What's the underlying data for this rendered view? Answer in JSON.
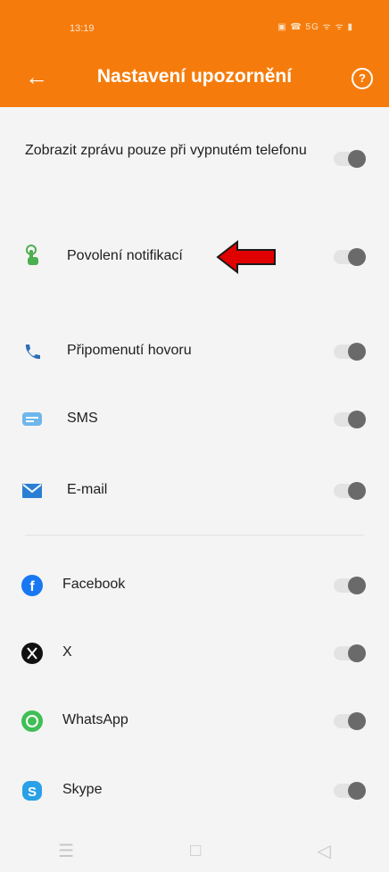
{
  "status": {
    "time": "13:19",
    "icons_text": "▣ ☎ 5G ᯤ ᯤ ▮"
  },
  "header": {
    "back_icon": "arrow-left-icon",
    "title": "Nastavení upozornění",
    "help_icon": "help-circle-icon",
    "help_label": "?"
  },
  "settings": [
    {
      "label": "Zobrazit zprávu pouze při vypnutém telefonu",
      "enabled": false
    },
    {
      "label": "Povolení notifikací",
      "icon": "touch-hand-icon",
      "enabled": false
    },
    {
      "label": "Připomenutí hovoru",
      "icon": "phone-icon",
      "enabled": false
    },
    {
      "label": "SMS",
      "icon": "sms-icon",
      "enabled": false
    },
    {
      "label": "E-mail",
      "icon": "email-icon",
      "enabled": false
    },
    {
      "label": "Facebook",
      "icon": "facebook-icon",
      "enabled": false
    },
    {
      "label": "X",
      "icon": "x-icon",
      "enabled": false
    },
    {
      "label": "WhatsApp",
      "icon": "whatsapp-icon",
      "enabled": false
    },
    {
      "label": "Skype",
      "icon": "skype-icon",
      "enabled": false
    }
  ],
  "navbar": {
    "menu": "☰",
    "home": "□",
    "back": "◁"
  },
  "colors": {
    "accent": "#f57c0c",
    "annotation_arrow": "#e00000"
  }
}
